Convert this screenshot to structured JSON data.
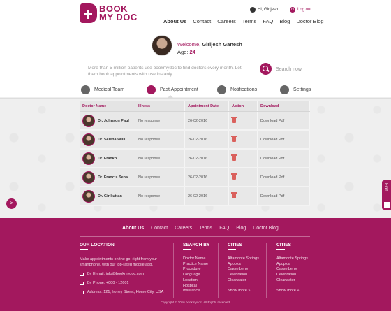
{
  "header": {
    "logo_line1": "BOOK",
    "logo_line2": "MY DOC",
    "user_greeting": "Hi, Girijesh",
    "logout_label": "Log out",
    "nav": [
      "About Us",
      "Contact",
      "Careers",
      "Terms",
      "FAQ",
      "Blog",
      "Doctor Blog"
    ]
  },
  "profile": {
    "welcome_prefix": "Welcome,",
    "name": "Girijesh Ganesh",
    "age_label": "Age:",
    "age_value": "24"
  },
  "tagline": "More than 5 million patients use bookmydoc to find doctors  every month. Let them book appointments with use instanly",
  "search": {
    "label": "Search now"
  },
  "tabs": [
    "Medical Team",
    "Past Appointment",
    "Notifications",
    "Settings"
  ],
  "table": {
    "headers": [
      "Doctor Name",
      "Illness",
      "Apointment Date",
      "Action",
      "Download"
    ],
    "rows": [
      {
        "doctor": "Dr. Johnson Paul",
        "illness": "No response",
        "date": "26-02-2016",
        "download": "Download Pdf"
      },
      {
        "doctor": "Dr. Selena Willi...",
        "illness": "No response",
        "date": "26-02-2016",
        "download": "Download Pdf"
      },
      {
        "doctor": "Dr. Franko",
        "illness": "No response",
        "date": "26-02-2016",
        "download": "Download Pdf"
      },
      {
        "doctor": "Dr. Francis Sena",
        "illness": "No response",
        "date": "26-02-2016",
        "download": "Download Pdf"
      },
      {
        "doctor": "Dr. Girikuttan",
        "illness": "No response",
        "date": "26-02-2016",
        "download": "Download Pdf"
      }
    ]
  },
  "side": {
    "find_label": "Find"
  },
  "footer": {
    "nav": [
      "About Us",
      "Contact",
      "Careers",
      "Terms",
      "FAQ",
      "Blog",
      "Doctor Blog"
    ],
    "location_title": "OUR LOCATION",
    "location_text": "Make appointments on the go, right from your smartphone, with our top-rated mobile app.",
    "email": "By E-mail: info@bookmydoc.com",
    "phone": "By Phone: +000 - 12601",
    "address": "Address: 121, honey Street, Home City, USA",
    "search_title": "SEARCH BY",
    "search_items": [
      "Doctor Name",
      "Practice Name",
      "Procedure",
      "Language",
      "Location",
      "Hospital",
      "Insurance"
    ],
    "cities_title": "CITIES",
    "cities1": [
      "Altamonte Springs",
      "Apopka",
      "Casselberry",
      "Celebration",
      "Clearwater"
    ],
    "cities2_title": "CITIES",
    "cities2": [
      "Altamonte Springs",
      "Apopka",
      "Casselberry",
      "Celebration",
      "Clearwater"
    ],
    "show_more": "Show more",
    "copyright": "Copyright © 2016 bookmydoc. All Rights reserved."
  },
  "colors": {
    "brand": "#a3185e"
  }
}
